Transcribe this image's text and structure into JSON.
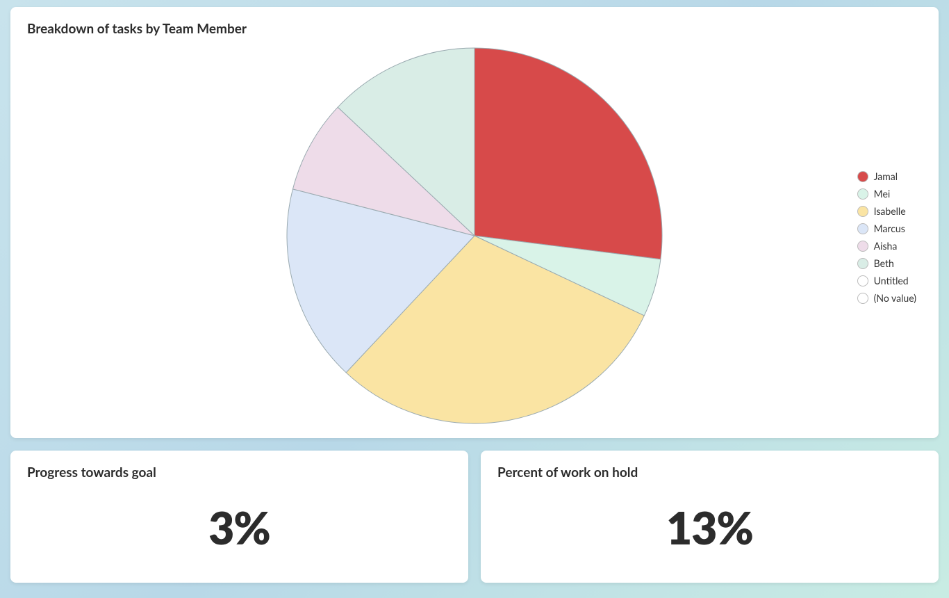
{
  "top": {
    "title": "Breakdown of tasks by Team Member"
  },
  "bottom": {
    "left": {
      "title": "Progress towards goal",
      "value": "3%"
    },
    "right": {
      "title": "Percent of work on hold",
      "value": "13%"
    }
  },
  "legend": [
    {
      "label": "Jamal",
      "color": "#d74a4a"
    },
    {
      "label": "Mei",
      "color": "#d9f3e8"
    },
    {
      "label": "Isabelle",
      "color": "#fae4a3"
    },
    {
      "label": "Marcus",
      "color": "#dbe6f7"
    },
    {
      "label": "Aisha",
      "color": "#eedce9"
    },
    {
      "label": "Beth",
      "color": "#d9ede6"
    },
    {
      "label": "Untitled",
      "color": "#ffffff"
    },
    {
      "label": "(No value)",
      "color": "#ffffff"
    }
  ],
  "chart_data": {
    "type": "pie",
    "title": "Breakdown of tasks by Team Member",
    "series": [
      {
        "name": "Jamal",
        "value": 27,
        "color": "#d74a4a"
      },
      {
        "name": "Mei",
        "value": 5,
        "color": "#d9f3e8"
      },
      {
        "name": "Isabelle",
        "value": 30,
        "color": "#fae4a3"
      },
      {
        "name": "Marcus",
        "value": 17,
        "color": "#dbe6f7"
      },
      {
        "name": "Aisha",
        "value": 8,
        "color": "#eedce9"
      },
      {
        "name": "Beth",
        "value": 13,
        "color": "#d9ede6"
      }
    ],
    "stroke": "#9aaab0",
    "radius": 270
  }
}
